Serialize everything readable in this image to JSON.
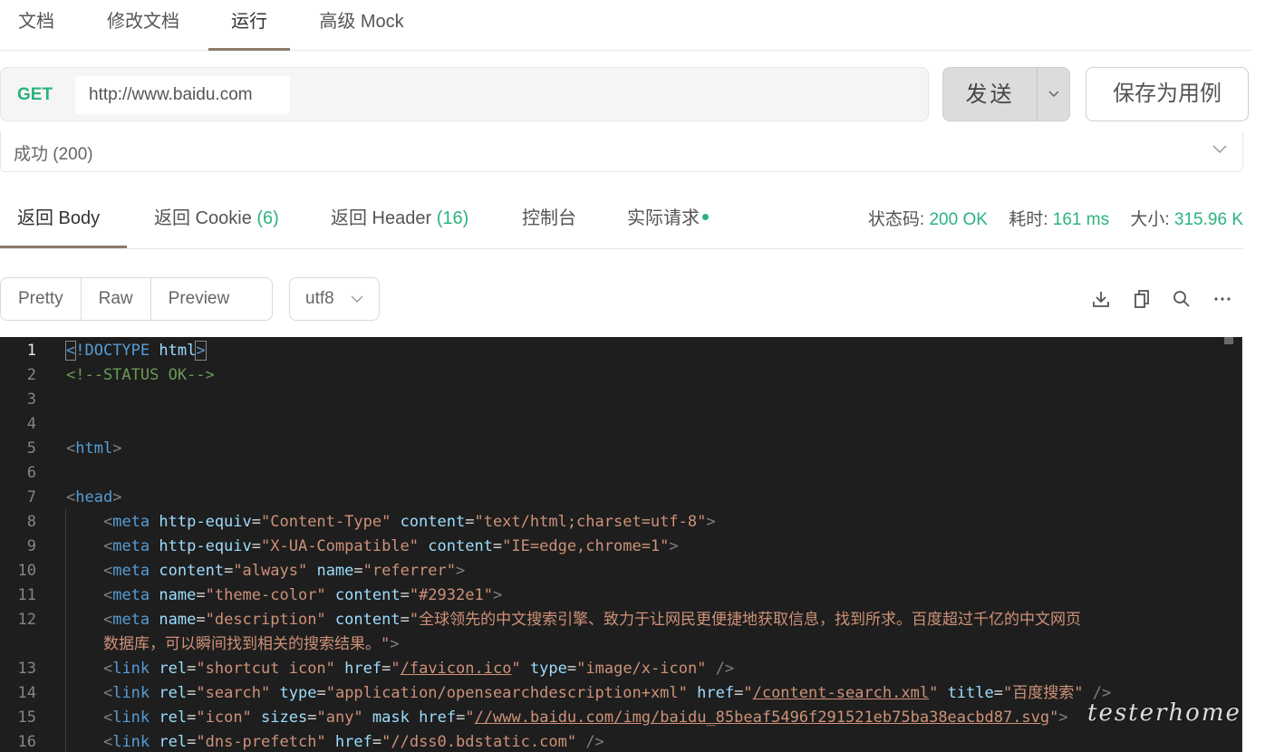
{
  "top_tabs": [
    {
      "label": "文档"
    },
    {
      "label": "修改文档"
    },
    {
      "label": "运行"
    },
    {
      "label": "高级 Mock"
    }
  ],
  "active_top_tab": "运行",
  "request": {
    "method": "GET",
    "url": "http://www.baidu.com",
    "send_label": "发送",
    "save_label": "保存为用例"
  },
  "status": {
    "text": "成功 (200)"
  },
  "response_tabs": [
    {
      "label": "返回 Body",
      "count": ""
    },
    {
      "label": "返回 Cookie",
      "count": "(6)"
    },
    {
      "label": "返回 Header",
      "count": "(16)"
    },
    {
      "label": "控制台",
      "count": ""
    },
    {
      "label": "实际请求",
      "count": ""
    }
  ],
  "metrics": {
    "status_label": "状态码:",
    "status_value": "200 OK",
    "time_label": "耗时:",
    "time_value": "161 ms",
    "size_label": "大小:",
    "size_value": "315.96 K"
  },
  "view_modes": [
    "Pretty",
    "Raw",
    "Preview"
  ],
  "encoding": "utf8",
  "toolbar_icons": [
    "download-icon",
    "copy-icon",
    "search-icon",
    "more-icon"
  ],
  "code_lines": [
    {
      "n": "1",
      "html": "<span class=\"c-tag bracket-hl\">&lt;</span><span class=\"c-tag\">!DOCTYPE</span> <span class=\"c-attr\">html</span><span class=\"c-tag bracket-hl\">&gt;</span>"
    },
    {
      "n": "2",
      "html": "<span class=\"c-com\">&lt;!--STATUS OK--&gt;</span>"
    },
    {
      "n": "3",
      "html": ""
    },
    {
      "n": "4",
      "html": ""
    },
    {
      "n": "5",
      "html": "<span class=\"c-pun\">&lt;</span><span class=\"c-tag\">html</span><span class=\"c-pun\">&gt;</span>"
    },
    {
      "n": "6",
      "html": ""
    },
    {
      "n": "7",
      "html": "<span class=\"c-pun\">&lt;</span><span class=\"c-tag\">head</span><span class=\"c-pun\">&gt;</span>"
    },
    {
      "n": "8",
      "html": "    <span class=\"c-pun\">&lt;</span><span class=\"c-tag\">meta</span> <span class=\"c-attr\">http-equiv</span>=<span class=\"c-str\">\"Content-Type\"</span> <span class=\"c-attr\">content</span>=<span class=\"c-str\">\"text/html;charset=utf-8\"</span><span class=\"c-pun\">&gt;</span>"
    },
    {
      "n": "9",
      "html": "    <span class=\"c-pun\">&lt;</span><span class=\"c-tag\">meta</span> <span class=\"c-attr\">http-equiv</span>=<span class=\"c-str\">\"X-UA-Compatible\"</span> <span class=\"c-attr\">content</span>=<span class=\"c-str\">\"IE=edge,chrome=1\"</span><span class=\"c-pun\">&gt;</span>"
    },
    {
      "n": "10",
      "html": "    <span class=\"c-pun\">&lt;</span><span class=\"c-tag\">meta</span> <span class=\"c-attr\">content</span>=<span class=\"c-str\">\"always\"</span> <span class=\"c-attr\">name</span>=<span class=\"c-str\">\"referrer\"</span><span class=\"c-pun\">&gt;</span>"
    },
    {
      "n": "11",
      "html": "    <span class=\"c-pun\">&lt;</span><span class=\"c-tag\">meta</span> <span class=\"c-attr\">name</span>=<span class=\"c-str\">\"theme-color\"</span> <span class=\"c-attr\">content</span>=<span class=\"c-str\">\"#2932e1\"</span><span class=\"c-pun\">&gt;</span>"
    },
    {
      "n": "12",
      "html": "    <span class=\"c-pun\">&lt;</span><span class=\"c-tag\">meta</span> <span class=\"c-attr\">name</span>=<span class=\"c-str\">\"description\"</span> <span class=\"c-attr\">content</span>=<span class=\"c-str\">\"全球领先的中文搜索引擎、致力于让网民更便捷地获取信息，找到所求。百度超过千亿的中文网页</span>"
    },
    {
      "n": "",
      "html": "    <span class=\"c-str\">数据库，可以瞬间找到相关的搜索结果。\"</span><span class=\"c-pun\">&gt;</span>"
    },
    {
      "n": "13",
      "html": "    <span class=\"c-pun\">&lt;</span><span class=\"c-tag\">link</span> <span class=\"c-attr\">rel</span>=<span class=\"c-str\">\"shortcut icon\"</span> <span class=\"c-attr\">href</span>=<span class=\"c-str\">\"</span><span class=\"c-link\">/favicon.ico</span><span class=\"c-str\">\"</span> <span class=\"c-attr\">type</span>=<span class=\"c-str\">\"image/x-icon\"</span> <span class=\"c-pun\">/&gt;</span>"
    },
    {
      "n": "14",
      "html": "    <span class=\"c-pun\">&lt;</span><span class=\"c-tag\">link</span> <span class=\"c-attr\">rel</span>=<span class=\"c-str\">\"search\"</span> <span class=\"c-attr\">type</span>=<span class=\"c-str\">\"application/opensearchdescription+xml\"</span> <span class=\"c-attr\">href</span>=<span class=\"c-str\">\"</span><span class=\"c-link\">/content-search.xml</span><span class=\"c-str\">\"</span> <span class=\"c-attr\">title</span>=<span class=\"c-str\">\"百度搜索\"</span> <span class=\"c-pun\">/&gt;</span>"
    },
    {
      "n": "15",
      "html": "    <span class=\"c-pun\">&lt;</span><span class=\"c-tag\">link</span> <span class=\"c-attr\">rel</span>=<span class=\"c-str\">\"icon\"</span> <span class=\"c-attr\">sizes</span>=<span class=\"c-str\">\"any\"</span> <span class=\"c-attr\">mask</span> <span class=\"c-attr\">href</span>=<span class=\"c-str\">\"</span><span class=\"c-link\">//www.baidu.com/img/baidu_85beaf5496f291521eb75ba38eacbd87.svg</span><span class=\"c-str\">\"</span><span class=\"c-pun\">&gt;</span>"
    },
    {
      "n": "16",
      "html": "    <span class=\"c-pun\">&lt;</span><span class=\"c-tag\">link</span> <span class=\"c-attr\">rel</span>=<span class=\"c-str\">\"dns-prefetch\"</span> <span class=\"c-attr\">href</span>=<span class=\"c-str\">\"//dss0.bdstatic.com\"</span> <span class=\"c-pun\">/&gt;</span>"
    }
  ],
  "watermark": "testerhome.com"
}
